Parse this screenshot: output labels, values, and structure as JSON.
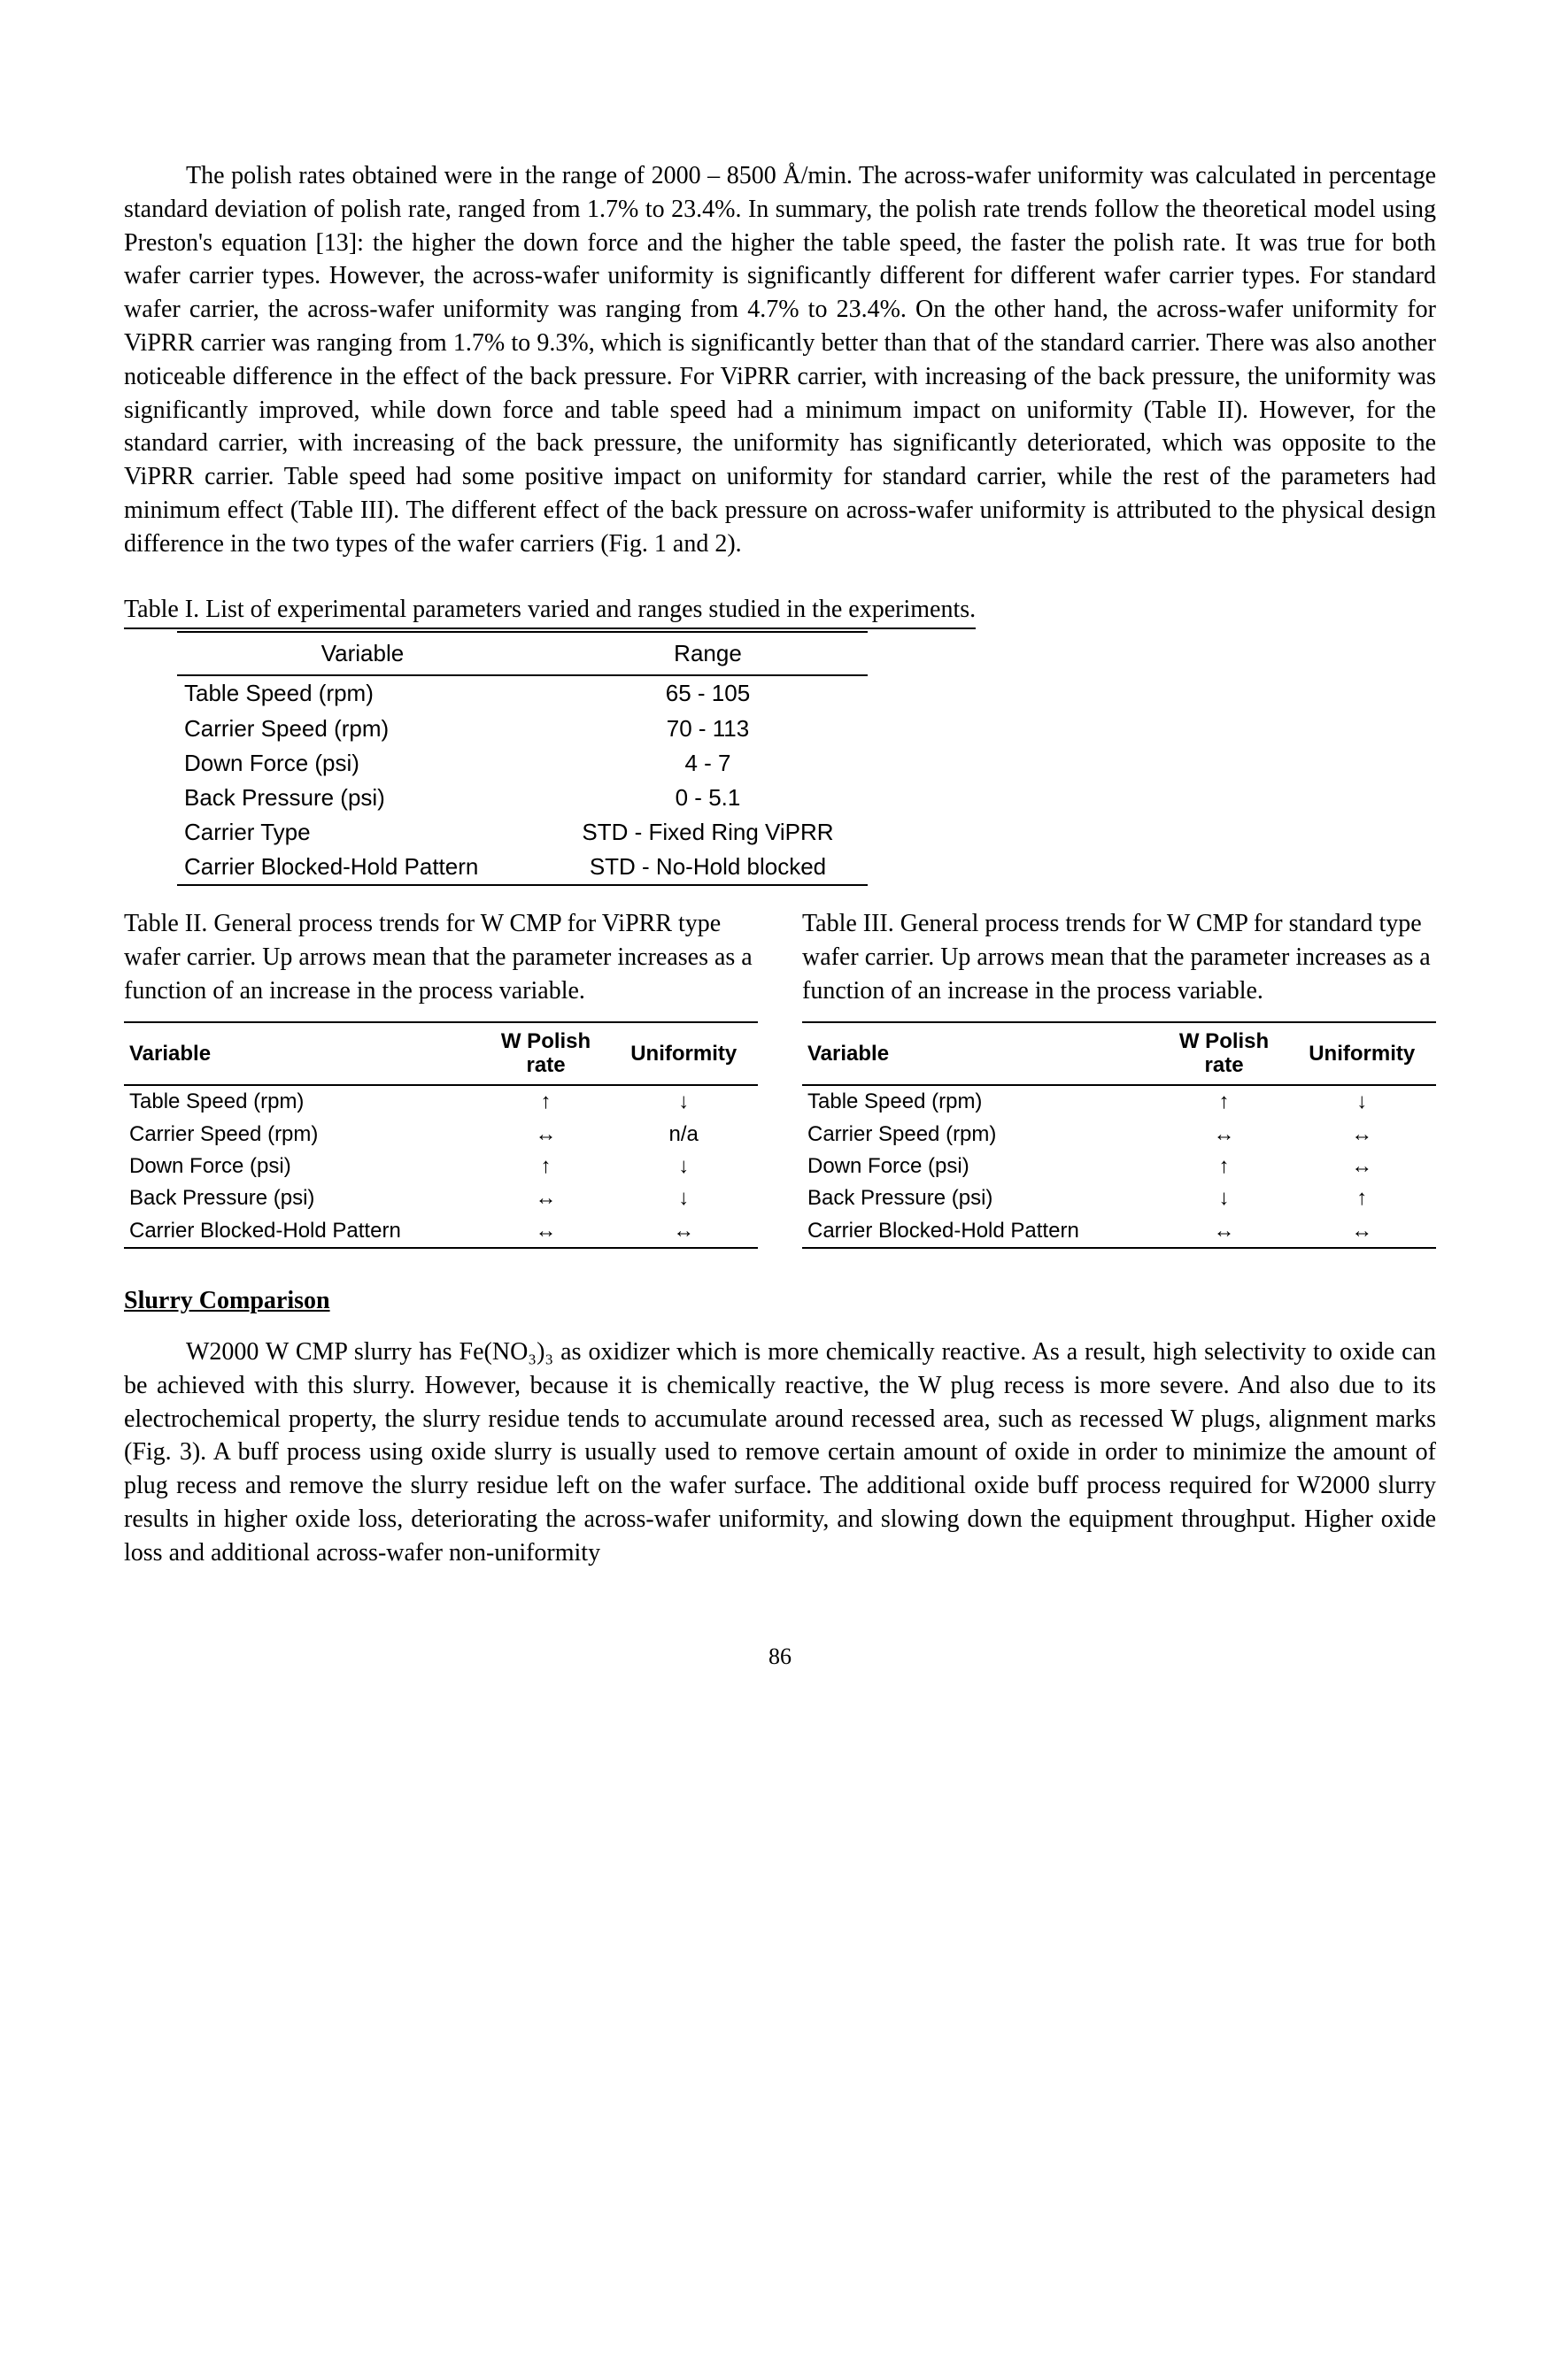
{
  "para1": "The polish rates obtained were in the range of 2000 – 8500 Å/min. The across-wafer uniformity was calculated in percentage standard deviation of polish rate, ranged from 1.7% to 23.4%. In summary, the polish rate trends follow the theoretical model using Preston's equation [13]: the higher the down force and the higher the table speed, the faster the polish rate. It was true for both wafer carrier types. However, the across-wafer uniformity is significantly different for different wafer carrier types. For standard wafer carrier, the across-wafer uniformity was ranging from 4.7% to 23.4%. On the other hand, the across-wafer uniformity for ViPRR carrier was ranging from 1.7% to 9.3%, which is significantly better than that of the standard carrier. There was also another noticeable difference in the effect of the back pressure. For ViPRR carrier, with increasing of the back pressure, the uniformity was significantly improved, while down force and table speed had a minimum impact on uniformity (Table II). However, for the standard carrier, with increasing of the back pressure, the uniformity has significantly deteriorated, which was opposite to the ViPRR carrier. Table speed had some positive impact on uniformity for standard carrier, while the rest of the parameters had minimum effect (Table III). The different effect of the back pressure on across-wafer uniformity is attributed to the physical design difference in the two types of the wafer carriers (Fig. 1 and 2).",
  "table1": {
    "title": "Table I. List of experimental parameters varied and ranges studied in the experiments.",
    "headers": {
      "var": "Variable",
      "range": "Range"
    },
    "rows": [
      {
        "var": "Table Speed (rpm)",
        "range": "65 - 105"
      },
      {
        "var": "Carrier Speed (rpm)",
        "range": "70 - 113"
      },
      {
        "var": "Down Force (psi)",
        "range": "4 - 7"
      },
      {
        "var": "Back Pressure (psi)",
        "range": "0 - 5.1"
      },
      {
        "var": "Carrier Type",
        "range": "STD - Fixed Ring ViPRR"
      },
      {
        "var": "Carrier Blocked-Hold Pattern",
        "range": "STD - No-Hold blocked"
      }
    ]
  },
  "table2": {
    "caption": "Table II. General process trends for W CMP for ViPRR type wafer carrier. Up arrows mean that the parameter increases as a function of an increase in the process variable.",
    "headers": {
      "var": "Variable",
      "rate": "W Polish rate",
      "unif": "Uniformity"
    },
    "rows": [
      {
        "var": "Table Speed (rpm)",
        "rate": "↑",
        "unif": "↓"
      },
      {
        "var": "Carrier Speed (rpm)",
        "rate": "↔",
        "unif": "n/a"
      },
      {
        "var": "Down Force (psi)",
        "rate": "↑",
        "unif": "↓"
      },
      {
        "var": "Back Pressure (psi)",
        "rate": "↔",
        "unif": "↓"
      },
      {
        "var": "Carrier Blocked-Hold Pattern",
        "rate": "↔",
        "unif": "↔"
      }
    ]
  },
  "table3": {
    "caption": "Table III. General process trends for W CMP for standard type wafer carrier. Up arrows mean that the parameter increases as a function of an increase in the process variable.",
    "headers": {
      "var": "Variable",
      "rate": "W Polish rate",
      "unif": "Uniformity"
    },
    "rows": [
      {
        "var": "Table Speed (rpm)",
        "rate": "↑",
        "unif": "↓"
      },
      {
        "var": "Carrier Speed (rpm)",
        "rate": "↔",
        "unif": "↔"
      },
      {
        "var": "Down Force (psi)",
        "rate": "↑",
        "unif": "↔"
      },
      {
        "var": "Back Pressure (psi)",
        "rate": "↓",
        "unif": "↑"
      },
      {
        "var": "Carrier Blocked-Hold Pattern",
        "rate": "↔",
        "unif": "↔"
      }
    ]
  },
  "section_heading": "Slurry Comparison",
  "para2": "W2000 W CMP slurry has Fe(NO₃)₃ as oxidizer which is more chemically reactive. As a result, high selectivity to oxide can be achieved with this slurry. However, because it is chemically reactive, the W plug recess is more severe. And also due to its electrochemical property, the slurry residue tends to accumulate around recessed area, such as recessed W plugs, alignment marks (Fig. 3). A buff process using oxide slurry is usually used to remove certain amount of oxide in order to minimize the amount of plug recess and remove the slurry residue left on the wafer surface. The additional oxide buff process required for W2000 slurry results in higher oxide loss, deteriorating the across-wafer uniformity, and slowing down the equipment throughput. Higher oxide loss and additional across-wafer non-uniformity",
  "page_number": "86"
}
